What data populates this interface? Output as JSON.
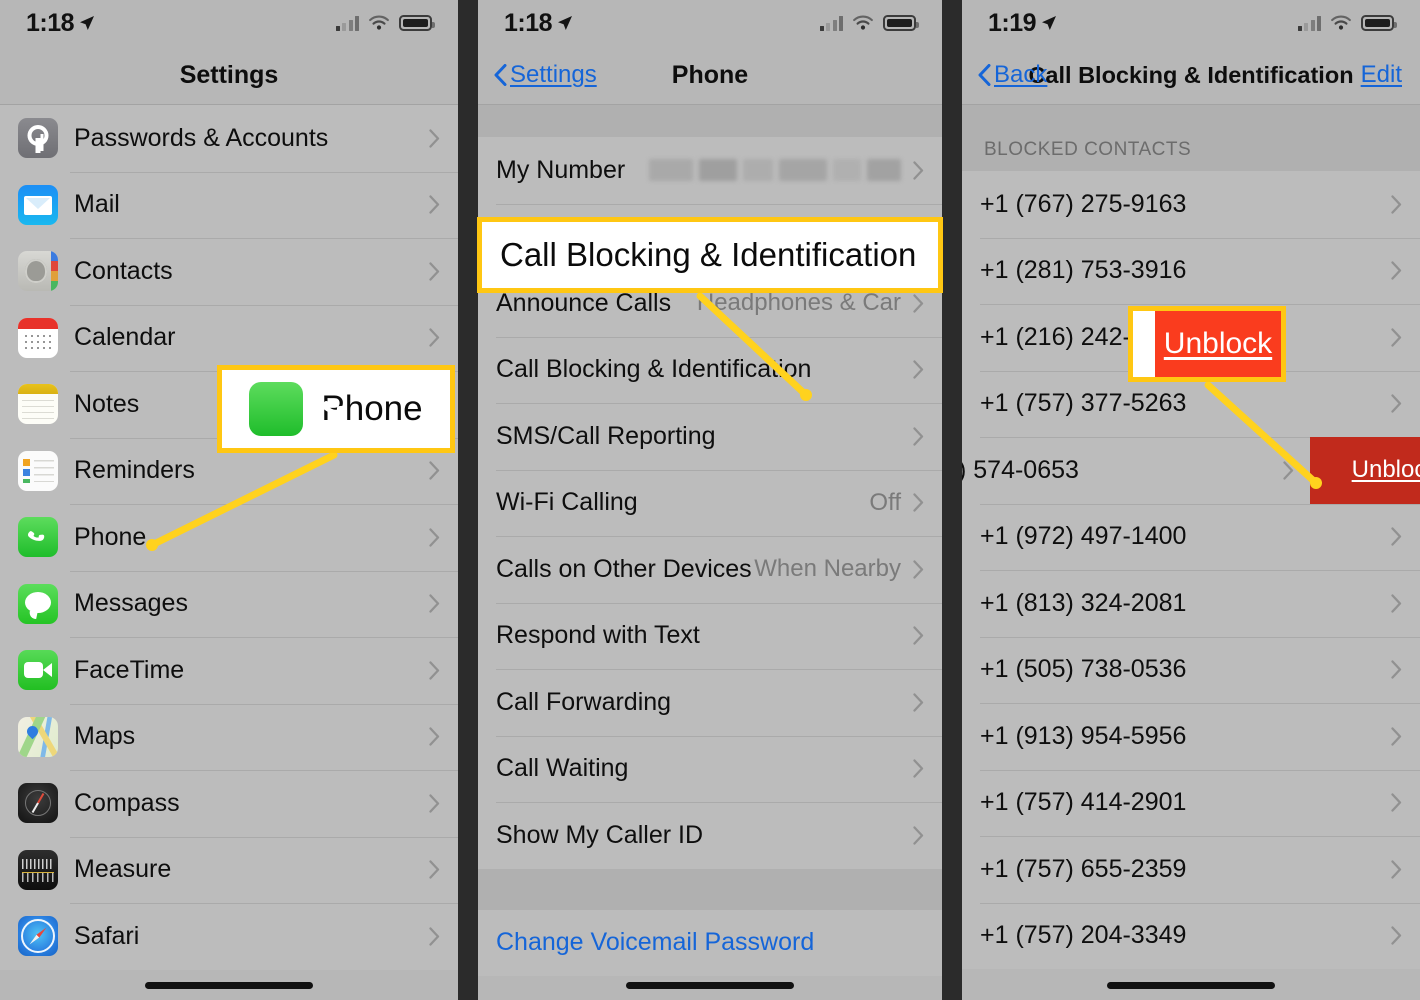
{
  "panels": {
    "settings": {
      "status": {
        "time": "1:18"
      },
      "nav": {
        "title": "Settings"
      },
      "items": [
        {
          "label": "Passwords & Accounts",
          "icon": "passwords-icon",
          "icon_class": "ic-pw"
        },
        {
          "label": "Mail",
          "icon": "mail-icon",
          "icon_class": "ic-mail"
        },
        {
          "label": "Contacts",
          "icon": "contacts-icon",
          "icon_class": "ic-contacts"
        },
        {
          "label": "Calendar",
          "icon": "calendar-icon",
          "icon_class": "ic-cal"
        },
        {
          "label": "Notes",
          "icon": "notes-icon",
          "icon_class": "ic-notes"
        },
        {
          "label": "Reminders",
          "icon": "reminders-icon",
          "icon_class": "ic-rem"
        },
        {
          "label": "Phone",
          "icon": "phone-icon",
          "icon_class": "ic-phone"
        },
        {
          "label": "Messages",
          "icon": "messages-icon",
          "icon_class": "ic-msg"
        },
        {
          "label": "FaceTime",
          "icon": "facetime-icon",
          "icon_class": "ic-ft"
        },
        {
          "label": "Maps",
          "icon": "maps-icon",
          "icon_class": "ic-maps"
        },
        {
          "label": "Compass",
          "icon": "compass-icon",
          "icon_class": "ic-compass"
        },
        {
          "label": "Measure",
          "icon": "measure-icon",
          "icon_class": "ic-measure"
        },
        {
          "label": "Safari",
          "icon": "safari-icon",
          "icon_class": "ic-safari"
        }
      ]
    },
    "phone": {
      "status": {
        "time": "1:18"
      },
      "nav": {
        "back_label": "Settings",
        "title": "Phone"
      },
      "items": [
        {
          "label": "My Number",
          "value": "",
          "redacted": true
        },
        {
          "label": "Call Blocking & Identification",
          "value": ""
        },
        {
          "label": "Announce Calls",
          "value": "Headphones & Car"
        },
        {
          "label": "Call Blocking & Identification",
          "value": ""
        },
        {
          "label": "SMS/Call Reporting",
          "value": ""
        },
        {
          "label": "Wi-Fi Calling",
          "value": "Off"
        },
        {
          "label": "Calls on Other Devices",
          "value": "When Nearby"
        },
        {
          "label": "Respond with Text",
          "value": ""
        },
        {
          "label": "Call Forwarding",
          "value": ""
        },
        {
          "label": "Call Waiting",
          "value": ""
        },
        {
          "label": "Show My Caller ID",
          "value": ""
        }
      ],
      "footer_link": "Change Voicemail Password"
    },
    "blocking": {
      "status": {
        "time": "1:19"
      },
      "nav": {
        "back_label": "Back",
        "title": "Call Blocking & Identification",
        "edit_label": "Edit"
      },
      "section_header": "BLOCKED CONTACTS",
      "contacts": [
        {
          "number": "+1 (767) 275-9163"
        },
        {
          "number": "+1 (281) 753-3916"
        },
        {
          "number": "+1 (216) 242-1"
        },
        {
          "number": "+1 (757) 377-5263"
        },
        {
          "number": ") 574-0653",
          "swiped": true,
          "action_label": "Unblock"
        },
        {
          "number": "+1 (972) 497-1400"
        },
        {
          "number": "+1 (813) 324-2081"
        },
        {
          "number": "+1 (505) 738-0536"
        },
        {
          "number": "+1 (913) 954-5956"
        },
        {
          "number": "+1 (757) 414-2901"
        },
        {
          "number": "+1 (757) 655-2359"
        },
        {
          "number": "+1 (757) 204-3349"
        }
      ]
    }
  },
  "callouts": {
    "phone": {
      "label": "Phone",
      "icon": "phone-app-icon"
    },
    "call_blocking": {
      "label": "Call Blocking & Identification"
    },
    "unblock": {
      "label": "Unblock"
    }
  },
  "colors": {
    "highlight_border": "#ffc713",
    "leader_line": "#ffd21e",
    "unblock_red": "#fa3c1e",
    "unblock_red_dark": "#c12a1c",
    "link_blue": "#1565d8",
    "panel_bg": "#b7b7b7"
  }
}
